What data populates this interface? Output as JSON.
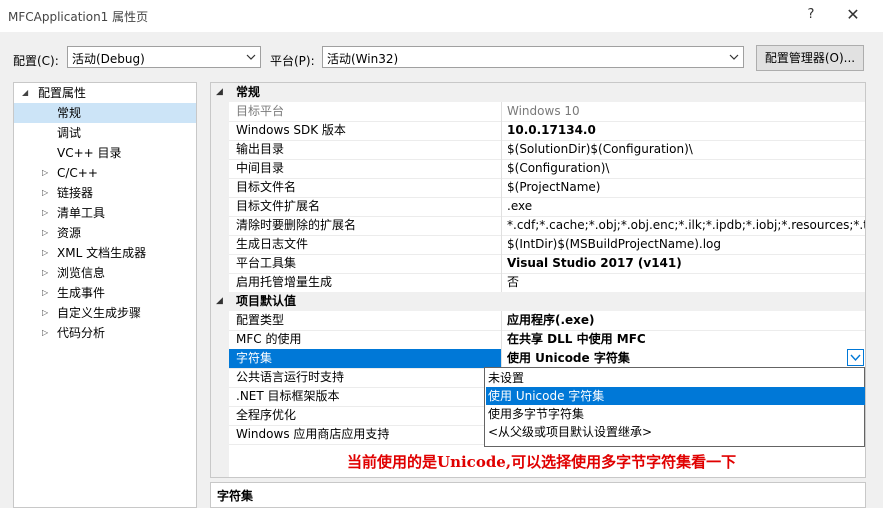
{
  "window": {
    "title": "MFCApplication1 属性页",
    "help": "?",
    "close": "✕"
  },
  "toolbar": {
    "config_label": "配置(C):",
    "config_value": "活动(Debug)",
    "platform_label": "平台(P):",
    "platform_value": "活动(Win32)",
    "config_manager": "配置管理器(O)..."
  },
  "tree": {
    "root": "配置属性",
    "items": [
      {
        "label": "常规",
        "expandable": false
      },
      {
        "label": "调试",
        "expandable": false
      },
      {
        "label": "VC++ 目录",
        "expandable": false
      },
      {
        "label": "C/C++",
        "expandable": true
      },
      {
        "label": "链接器",
        "expandable": true
      },
      {
        "label": "清单工具",
        "expandable": true
      },
      {
        "label": "资源",
        "expandable": true
      },
      {
        "label": "XML 文档生成器",
        "expandable": true
      },
      {
        "label": "浏览信息",
        "expandable": true
      },
      {
        "label": "生成事件",
        "expandable": true
      },
      {
        "label": "自定义生成步骤",
        "expandable": true
      },
      {
        "label": "代码分析",
        "expandable": true
      }
    ]
  },
  "grid": {
    "cat_general": "常规",
    "general": [
      {
        "name": "目标平台",
        "value": "Windows 10"
      },
      {
        "name": "Windows SDK 版本",
        "value": "10.0.17134.0"
      },
      {
        "name": "输出目录",
        "value": "$(SolutionDir)$(Configuration)\\"
      },
      {
        "name": "中间目录",
        "value": "$(Configuration)\\"
      },
      {
        "name": "目标文件名",
        "value": "$(ProjectName)"
      },
      {
        "name": "目标文件扩展名",
        "value": ".exe"
      },
      {
        "name": "清除时要删除的扩展名",
        "value": "*.cdf;*.cache;*.obj;*.obj.enc;*.ilk;*.ipdb;*.iobj;*.resources;*.tlb;*.tli;*.t"
      },
      {
        "name": "生成日志文件",
        "value": "$(IntDir)$(MSBuildProjectName).log"
      },
      {
        "name": "平台工具集",
        "value": "Visual Studio 2017 (v141)"
      },
      {
        "name": "启用托管增量生成",
        "value": "否"
      }
    ],
    "cat_defaults": "项目默认值",
    "defaults": [
      {
        "name": "配置类型",
        "value": "应用程序(.exe)"
      },
      {
        "name": "MFC 的使用",
        "value": "在共享 DLL 中使用 MFC"
      },
      {
        "name": "字符集",
        "value": "使用 Unicode 字符集"
      },
      {
        "name": "公共语言运行时支持",
        "value": ""
      },
      {
        "name": ".NET 目标框架版本",
        "value": ""
      },
      {
        "name": "全程序优化",
        "value": ""
      },
      {
        "name": "Windows 应用商店应用支持",
        "value": ""
      }
    ]
  },
  "dropdown": {
    "options": [
      "未设置",
      "使用 Unicode 字符集",
      "使用多字节字符集",
      "<从父级或项目默认设置继承>"
    ],
    "highlighted": 1
  },
  "annotation": "当前使用的是Unicode,可以选择使用多字节字符集看一下",
  "description": {
    "title": "字符集"
  },
  "colors": {
    "selection": "#0078d7",
    "tree_selection": "#cce4f7",
    "annotation": "#e00000"
  }
}
